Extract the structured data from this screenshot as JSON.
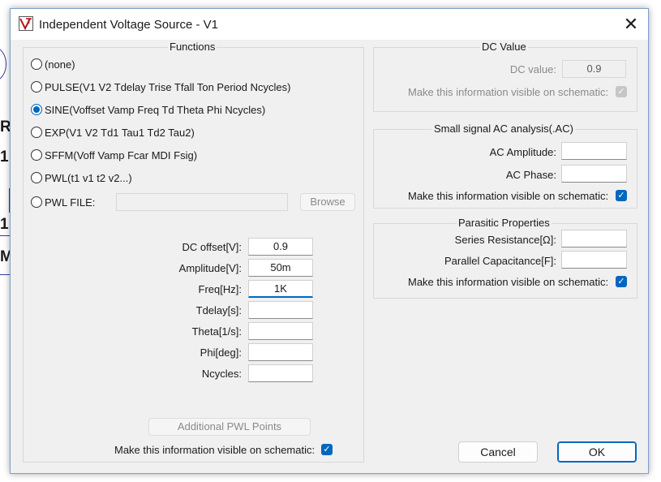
{
  "background": {
    "letters": [
      "R",
      "1",
      "1",
      "M"
    ]
  },
  "dialog": {
    "title": "Independent Voltage Source - V1",
    "close_glyph": "✕",
    "icon": "ltspice-app-icon"
  },
  "functions": {
    "legend": "Functions",
    "options": [
      {
        "label": "(none)",
        "selected": false
      },
      {
        "label": "PULSE(V1 V2 Tdelay Trise Tfall Ton Period Ncycles)",
        "selected": false
      },
      {
        "label": "SINE(Voffset Vamp Freq Td Theta Phi Ncycles)",
        "selected": true
      },
      {
        "label": "EXP(V1 V2 Td1 Tau1 Td2 Tau2)",
        "selected": false
      },
      {
        "label": "SFFM(Voff Vamp Fcar MDI Fsig)",
        "selected": false
      },
      {
        "label": "PWL(t1 v1 t2 v2...)",
        "selected": false
      },
      {
        "label": "PWL FILE:",
        "selected": false
      }
    ],
    "pwl_file_value": "",
    "browse_label": "Browse",
    "params": [
      {
        "label": "DC offset[V]:",
        "value": "0.9"
      },
      {
        "label": "Amplitude[V]:",
        "value": "50m"
      },
      {
        "label": "Freq[Hz]:",
        "value": "1K"
      },
      {
        "label": "Tdelay[s]:",
        "value": ""
      },
      {
        "label": "Theta[1/s]:",
        "value": ""
      },
      {
        "label": "Phi[deg]:",
        "value": ""
      },
      {
        "label": "Ncycles:",
        "value": ""
      }
    ],
    "additional_pwl_label": "Additional PWL Points",
    "visible_label": "Make this information visible on schematic:",
    "visible_checked": true
  },
  "dc_value": {
    "legend": "DC Value",
    "label": "DC value:",
    "value": "0.9",
    "visible_label": "Make this information visible on schematic:",
    "visible_checked": true
  },
  "ac": {
    "legend": "Small signal AC analysis(.AC)",
    "amplitude_label": "AC Amplitude:",
    "amplitude_value": "",
    "phase_label": "AC Phase:",
    "phase_value": "",
    "visible_label": "Make this information visible on schematic:",
    "visible_checked": true
  },
  "parasitic": {
    "legend": "Parasitic Properties",
    "series_label": "Series Resistance[Ω]:",
    "series_value": "",
    "parallel_label": "Parallel Capacitance[F]:",
    "parallel_value": "",
    "visible_label": "Make this information visible on schematic:",
    "visible_checked": true
  },
  "buttons": {
    "cancel": "Cancel",
    "ok": "OK"
  },
  "check_glyph": "✓",
  "colors": {
    "accent": "#0067c0",
    "dialog_bg": "#f0f0f0",
    "disabled_text": "#8a8a8a"
  }
}
